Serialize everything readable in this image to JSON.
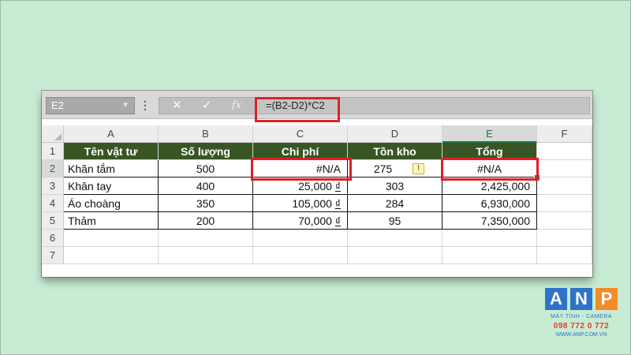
{
  "formula_bar": {
    "name_box": "E2",
    "name_box_dropdown_icon": "chevron-down-icon",
    "kebab_icon": "vertical-dots-icon",
    "cancel_icon": "close-icon",
    "enter_icon": "checkmark-icon",
    "function_label": "fx",
    "formula": "=(B2-D2)*C2"
  },
  "columns": [
    "A",
    "B",
    "C",
    "D",
    "E",
    "F"
  ],
  "rows": [
    "1",
    "2",
    "3",
    "4",
    "5",
    "6",
    "7"
  ],
  "table": {
    "headers": [
      "Tên vật tư",
      "Số lượng",
      "Chi phí",
      "Tồn kho",
      "Tổng"
    ],
    "rows": [
      {
        "name": "Khăn tắm",
        "qty": "500",
        "cost": "#N/A",
        "cost_currency": "",
        "stock": "275",
        "total": "#N/A"
      },
      {
        "name": "Khăn tay",
        "qty": "400",
        "cost": "25,000",
        "cost_currency": "₫",
        "stock": "303",
        "total": "2,425,000"
      },
      {
        "name": "Áo choàng",
        "qty": "350",
        "cost": "105,000",
        "cost_currency": "₫",
        "stock": "284",
        "total": "6,930,000"
      },
      {
        "name": "Thảm",
        "qty": "200",
        "cost": "70,000",
        "cost_currency": "₫",
        "stock": "95",
        "total": "7,350,000"
      }
    ]
  },
  "warning_icon": "warning-diamond-icon",
  "selected_cell": "E2",
  "colors": {
    "header_fill": "#375623",
    "excel_green": "#217346",
    "highlight_red": "#e01f26",
    "background": "#c8ecd3"
  },
  "logo": {
    "letters": [
      "A",
      "N",
      "P"
    ],
    "tagline": "MÁY TÍNH - CAMERA",
    "phone": "098 772 0 772",
    "website": "WWW.ANP.COM.VN"
  }
}
